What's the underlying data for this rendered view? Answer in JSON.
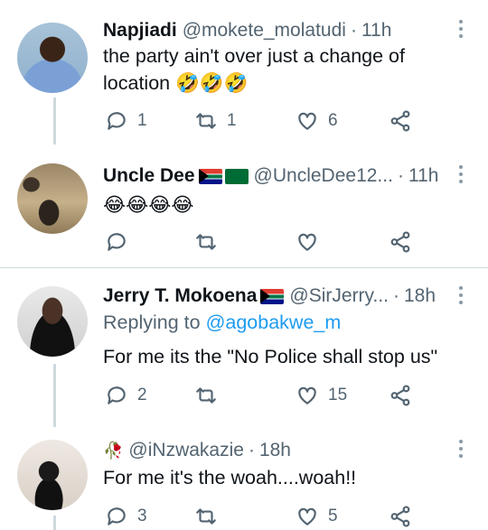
{
  "tweets": [
    {
      "display_name": "Napjiadi",
      "handle": "@mokete_molatudi",
      "separator": "·",
      "time": "11h",
      "text": "the party  ain't over just a change of location",
      "emoji": "🤣🤣🤣",
      "reply_count": "1",
      "retweet_count": "1",
      "like_count": "6"
    },
    {
      "display_name": "Uncle Dee",
      "handle": "@UncleDee12...",
      "separator": "·",
      "time": "11h",
      "text": "",
      "emoji": "😂😂😂😂",
      "reply_count": "",
      "retweet_count": "",
      "like_count": ""
    },
    {
      "display_name": "Jerry T. Mokoena",
      "handle": "@SirJerry...",
      "separator": "·",
      "time": "18h",
      "replying_prefix": "Replying to",
      "replying_to": "@agobakwe_m",
      "text": "For me its the \"No Police shall stop us\"",
      "reply_count": "2",
      "retweet_count": "",
      "like_count": "15"
    },
    {
      "display_name": "",
      "name_emoji": "🥀",
      "handle": "@iNzwakazie",
      "separator": "·",
      "time": "18h",
      "text": "For me it's the woah....woah!!",
      "reply_count": "3",
      "retweet_count": "",
      "like_count": "5"
    }
  ],
  "colors": {
    "link": "#1d9bf0",
    "secondary_text": "#536471",
    "divider": "#cfd9de"
  }
}
